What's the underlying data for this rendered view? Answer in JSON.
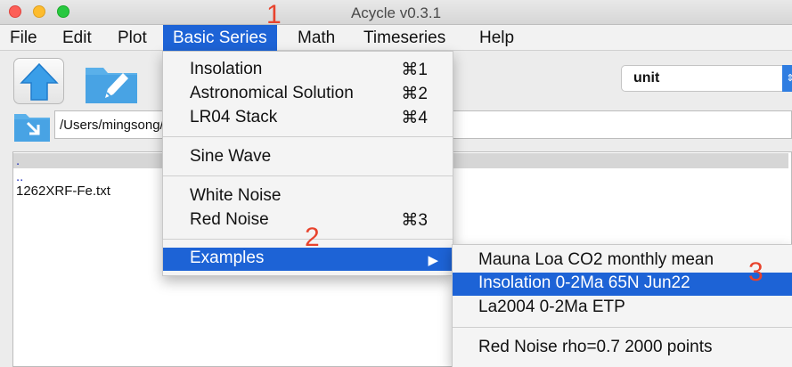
{
  "window": {
    "title": "Acycle v0.3.1"
  },
  "menubar": {
    "items": [
      {
        "label": "File"
      },
      {
        "label": "Edit"
      },
      {
        "label": "Plot"
      },
      {
        "label": "Basic Series"
      },
      {
        "label": "Math"
      },
      {
        "label": "Timeseries"
      },
      {
        "label": "Help"
      }
    ]
  },
  "toolbar": {
    "unit_select": {
      "value": "unit"
    }
  },
  "path": {
    "value": "/Users/mingsong/Acycle/case"
  },
  "file_list": {
    "items": [
      ".",
      "..",
      "1262XRF-Fe.txt"
    ]
  },
  "basic_series_menu": {
    "items": [
      {
        "label": "Insolation",
        "shortcut": "⌘1"
      },
      {
        "label": "Astronomical Solution",
        "shortcut": "⌘2"
      },
      {
        "label": "LR04 Stack",
        "shortcut": "⌘4"
      },
      {
        "label": "Sine Wave",
        "shortcut": ""
      },
      {
        "label": "White Noise",
        "shortcut": ""
      },
      {
        "label": "Red Noise",
        "shortcut": "⌘3"
      },
      {
        "label": "Examples",
        "shortcut": ""
      }
    ]
  },
  "examples_submenu": {
    "items": [
      {
        "label": "Mauna Loa CO2 monthly mean"
      },
      {
        "label": "Insolation 0-2Ma 65N Jun22"
      },
      {
        "label": "La2004 0-2Ma ETP"
      },
      {
        "label": "Red Noise rho=0.7 2000 points"
      }
    ]
  },
  "annotations": {
    "step1": "1",
    "step2": "2",
    "step3": "3"
  },
  "colors": {
    "highlight": "#1d63d6",
    "annotation": "#e8432d"
  },
  "icons": [
    "upload-arrow-icon",
    "folder-edit-icon",
    "folder-arrow-icon",
    "submenu-arrow-icon",
    "stepper-arrows-icon"
  ]
}
